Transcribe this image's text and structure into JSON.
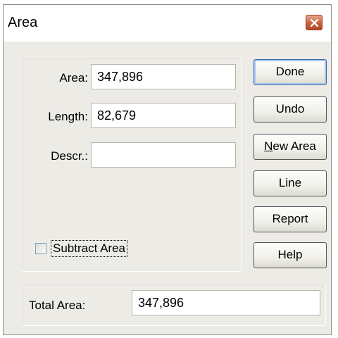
{
  "window": {
    "title": "Area"
  },
  "fields": {
    "area": {
      "label": "Area:",
      "value": "347,896"
    },
    "length": {
      "label": "Length:",
      "value": "82,679"
    },
    "descr": {
      "label": "Descr.:",
      "value": ""
    }
  },
  "checkbox": {
    "subtract_area_label": "Subtract Area",
    "checked": false
  },
  "total": {
    "label": "Total Area:",
    "value": "347,896"
  },
  "buttons": {
    "done": "Done",
    "undo": "Undo",
    "new_area_mnemonic": "N",
    "new_area_rest": "ew Area",
    "line": "Line",
    "report": "Report",
    "help": "Help"
  },
  "icons": {
    "close": "close-icon"
  },
  "colors": {
    "dialog_bg": "#ecebe6",
    "close_button": "#c55f3c",
    "default_button_border": "#3c6ca8"
  }
}
